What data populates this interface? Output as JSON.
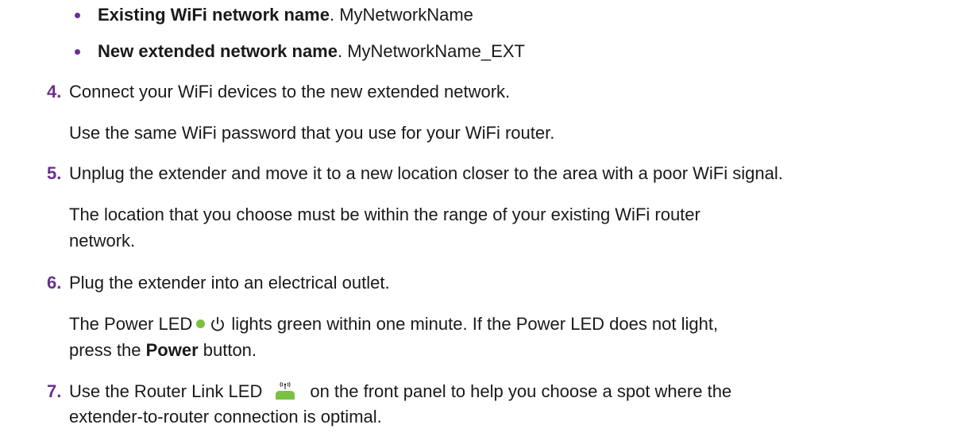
{
  "colors": {
    "accent": "#6b2f8e",
    "text": "#1a1a1a",
    "led_green": "#7ac143"
  },
  "bullets": [
    {
      "label": "Existing WiFi network name",
      "value": ". MyNetworkName"
    },
    {
      "label": "New extended network name",
      "value": ". MyNetworkName_EXT"
    }
  ],
  "steps": {
    "s4": {
      "number": "4.",
      "text": "Connect your WiFi devices to the new extended network.",
      "note": "Use the same WiFi password that you use for your WiFi router."
    },
    "s5": {
      "number": "5.",
      "text": "Unplug the extender and move it to a new location closer to the area with a poor WiFi signal.",
      "note_line1": "The location that you choose must be within the range of your existing WiFi router",
      "note_line2": "network."
    },
    "s6": {
      "number": "6.",
      "text": "Plug the extender into an electrical outlet.",
      "note_pre": "The Power LED",
      "note_post": "lights green within one minute. If the Power LED does not light,",
      "note_line2_pre": "press the ",
      "note_line2_bold": "Power",
      "note_line2_post": " button."
    },
    "s7": {
      "number": "7.",
      "text_pre": "Use the Router Link LED",
      "text_post": "on the front panel to help you choose a spot where the",
      "text_line2": "extender-to-router connection is optimal."
    }
  },
  "icons": {
    "power": "power-icon",
    "router_link": "router-link-led-icon",
    "led": "green-led-dot"
  }
}
